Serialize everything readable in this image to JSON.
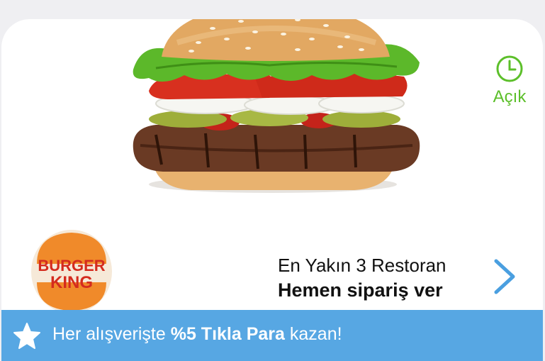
{
  "status": {
    "label": "Açık",
    "icon": "clock-icon",
    "color": "#5cbf2a"
  },
  "brand": {
    "logo_line1": "BURGER",
    "logo_line2": "KING"
  },
  "cta": {
    "subtitle": "En Yakın 3 Restoran",
    "title": "Hemen sipariş ver",
    "icon": "chevron-right-icon",
    "accent": "#4a9fe0"
  },
  "promo": {
    "prefix": "Her alışverişte ",
    "highlight": "%5 Tıkla Para",
    "suffix": " kazan!",
    "icon": "star-icon",
    "background": "#57a7e3"
  }
}
